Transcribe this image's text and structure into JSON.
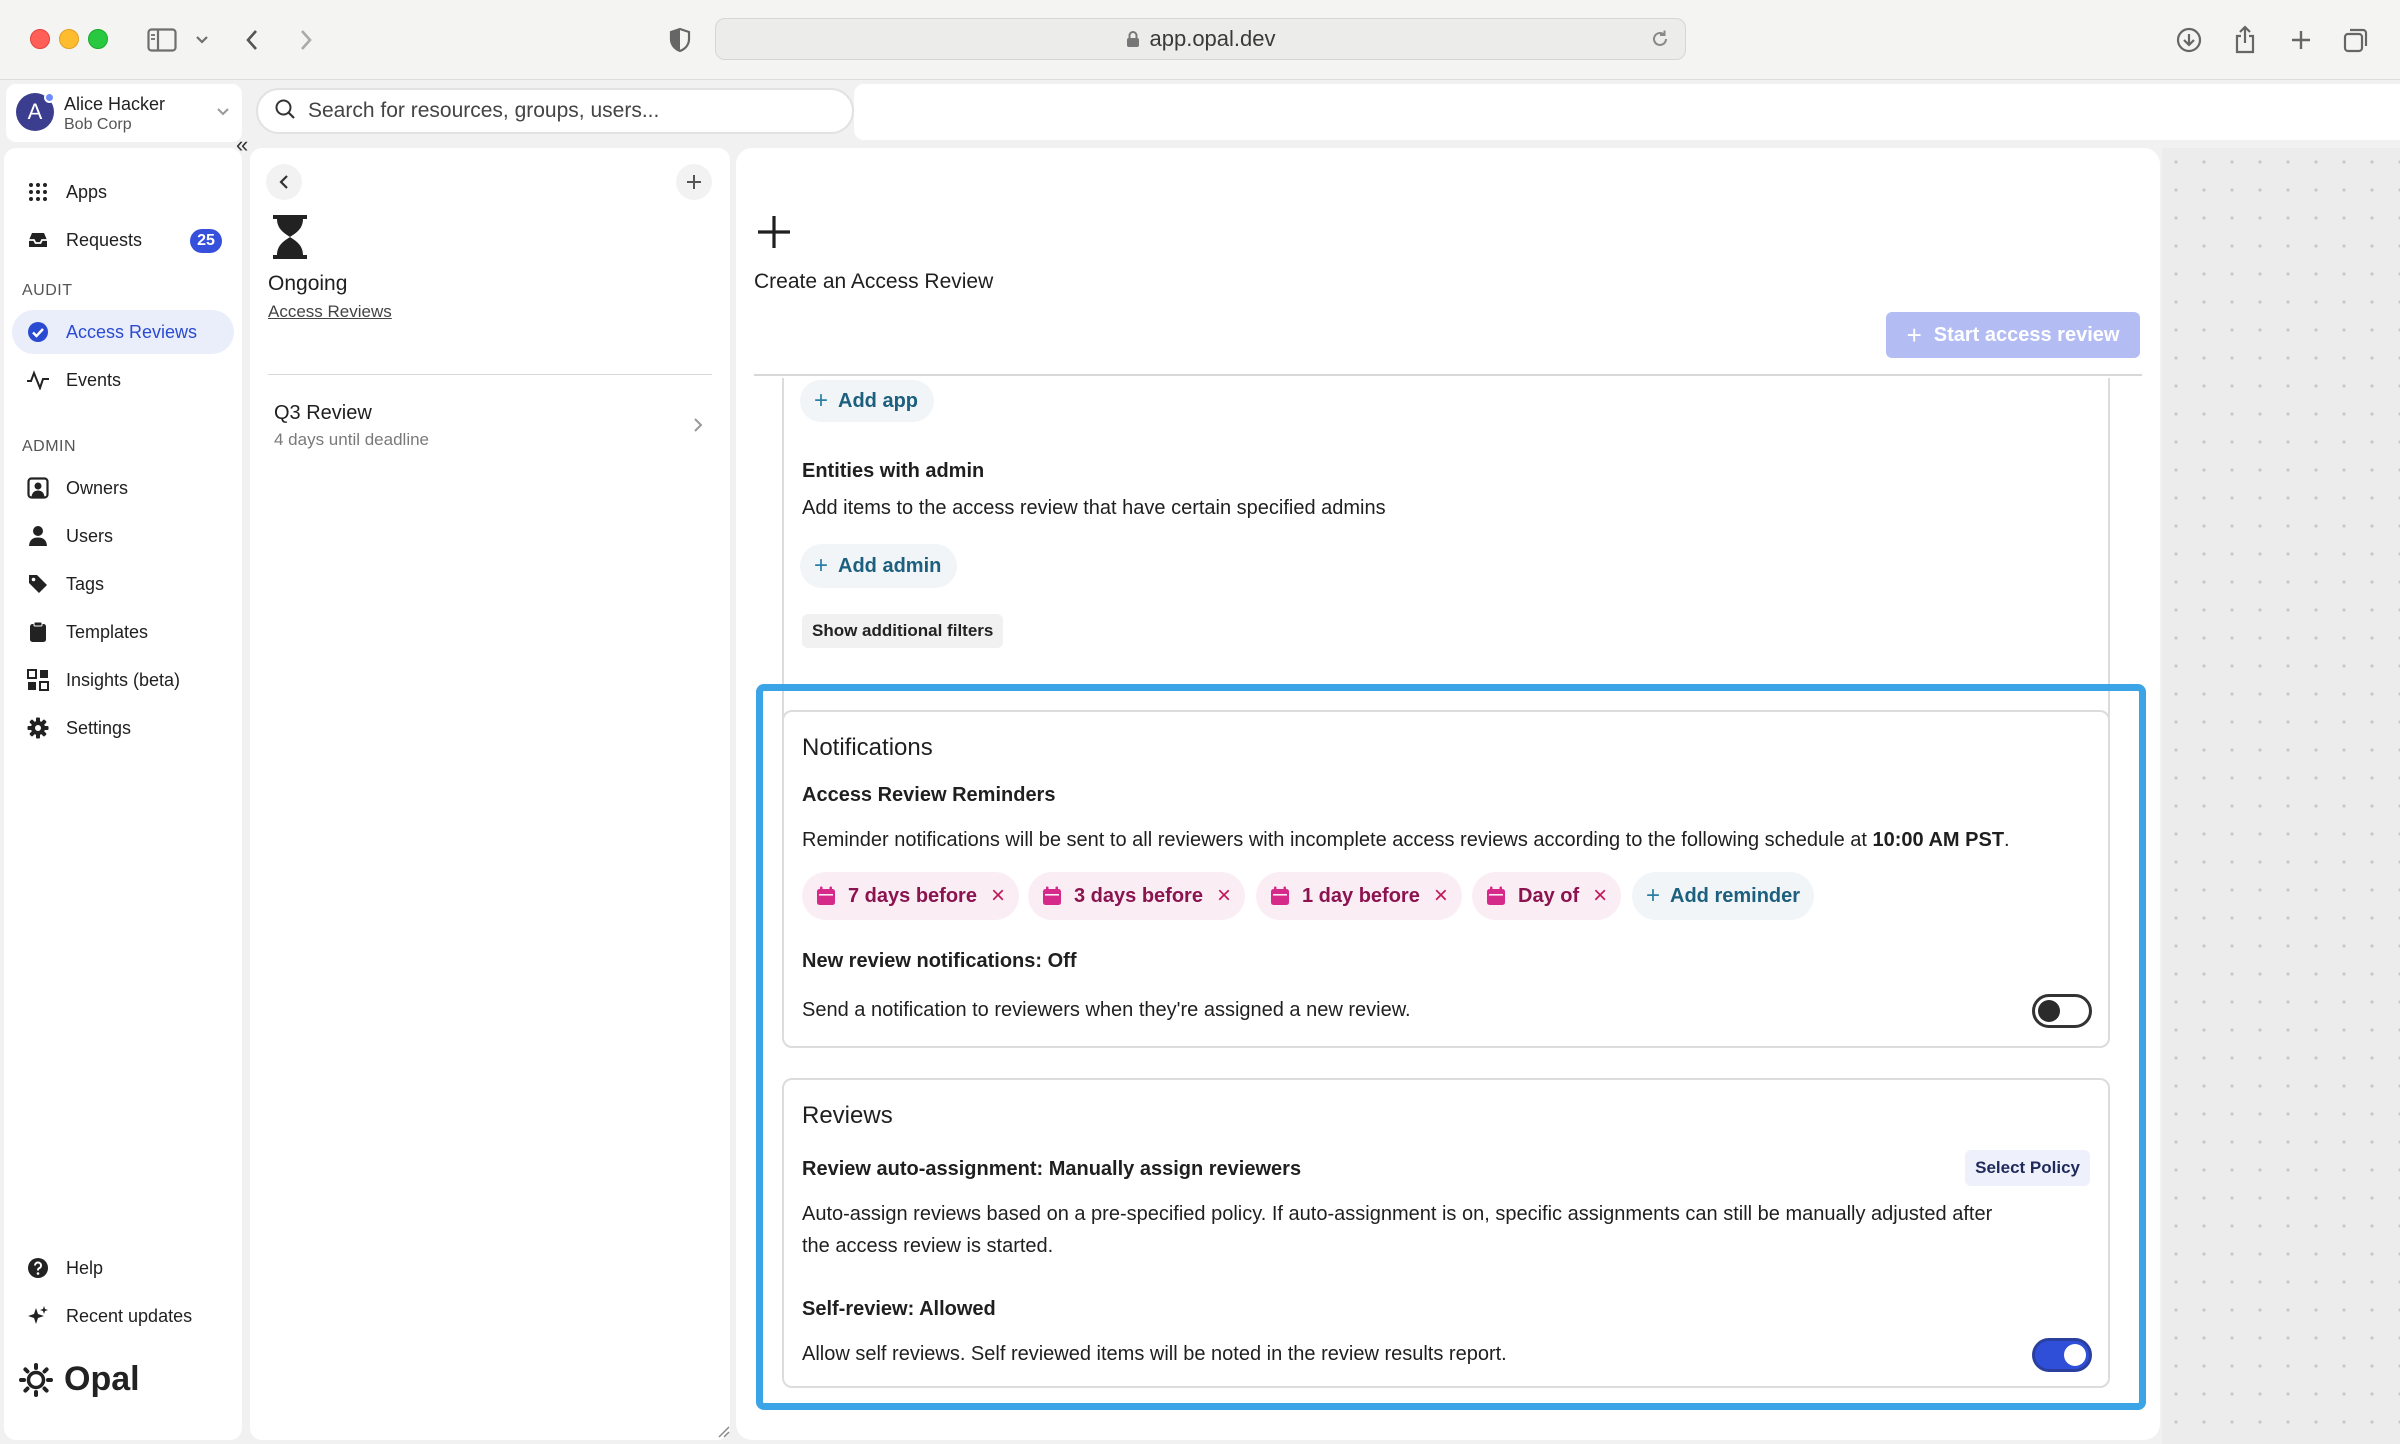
{
  "browser": {
    "url": "app.opal.dev"
  },
  "user": {
    "name": "Alice Hacker",
    "org": "Bob Corp",
    "avatar_letter": "A"
  },
  "search": {
    "placeholder": "Search for resources, groups, users..."
  },
  "sidebar": {
    "top_items": [
      {
        "label": "Apps",
        "icon": "grid-icon"
      },
      {
        "label": "Requests",
        "icon": "inbox-icon",
        "badge": "25"
      }
    ],
    "audit_heading": "AUDIT",
    "audit_items": [
      {
        "label": "Access Reviews",
        "icon": "check-circle-icon",
        "active": true
      },
      {
        "label": "Events",
        "icon": "activity-icon"
      }
    ],
    "admin_heading": "ADMIN",
    "admin_items": [
      {
        "label": "Owners",
        "icon": "owner-icon"
      },
      {
        "label": "Users",
        "icon": "user-icon"
      },
      {
        "label": "Tags",
        "icon": "tag-icon"
      },
      {
        "label": "Templates",
        "icon": "clipboard-icon"
      },
      {
        "label": "Insights (beta)",
        "icon": "insights-icon"
      },
      {
        "label": "Settings",
        "icon": "gear-icon"
      }
    ],
    "bottom_items": [
      {
        "label": "Help",
        "icon": "help-icon"
      },
      {
        "label": "Recent updates",
        "icon": "sparkle-icon"
      }
    ],
    "logo_text": "Opal"
  },
  "middle": {
    "title": "Ongoing",
    "breadcrumb": "Access Reviews",
    "reviews": [
      {
        "name": "Q3 Review",
        "subtitle": "4 days until deadline"
      }
    ]
  },
  "main": {
    "title": "Create an Access Review",
    "start_button": "Start access review",
    "add_app_label": "Add app",
    "entities_admin_heading": "Entities with admin",
    "entities_admin_desc": "Add items to the access review that have certain specified admins",
    "add_admin_label": "Add admin",
    "show_filters_label": "Show additional filters",
    "notifications": {
      "title": "Notifications",
      "reminders_heading": "Access Review Reminders",
      "reminders_desc": "Reminder notifications will be sent to all reviewers with incomplete access reviews according to the following schedule at ",
      "reminders_time": "10:00 AM PST",
      "reminders_period": ".",
      "reminders": [
        "7 days before",
        "3 days before",
        "1 day before",
        "Day of"
      ],
      "add_reminder_label": "Add reminder",
      "new_review_heading": "New review notifications: Off",
      "new_review_desc": "Send a notification to reviewers when they're assigned a new review.",
      "new_review_enabled": false
    },
    "reviews": {
      "title": "Reviews",
      "auto_heading": "Review auto-assignment: Manually assign reviewers",
      "select_policy_label": "Select Policy",
      "auto_desc_line1": "Auto-assign reviews based on a pre-specified policy. If auto-assignment is on, specific assignments can still be manually adjusted after",
      "auto_desc_line2": "the access review is started.",
      "self_heading": "Self-review: Allowed",
      "self_desc": "Allow self reviews. Self reviewed items will be noted in the review results report.",
      "self_enabled": true
    }
  },
  "colors": {
    "accent": "#3650dc",
    "highlight_border": "#3aa4e6",
    "chip_bg": "#fbedf4",
    "chip_text": "#8b1450"
  }
}
